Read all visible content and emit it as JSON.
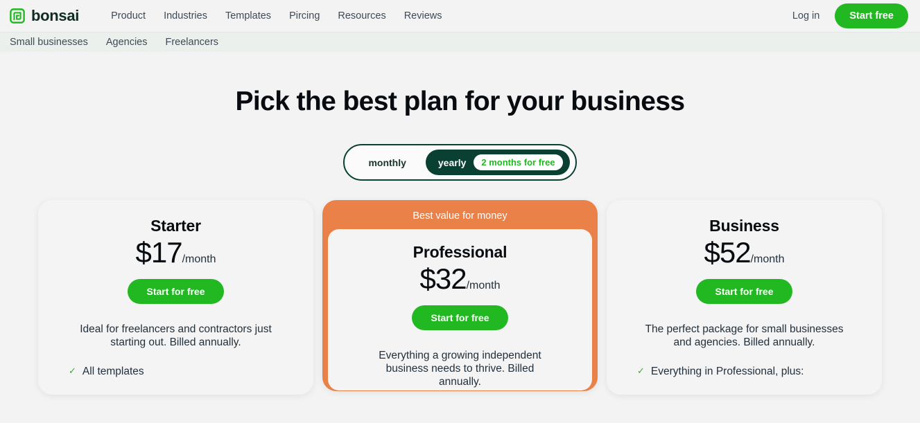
{
  "brand": {
    "name": "bonsai",
    "logo_icon": "bonsai-square-spiral-logo",
    "color": "#21B821"
  },
  "theme": {
    "accent_green": "#21B821",
    "dark_green": "#0A4032",
    "highlight_orange": "#EA8148",
    "page_bg": "#F2F3F2",
    "card_bg": "#F4F4F4",
    "subnav_bg": "#EBF0EC"
  },
  "header": {
    "nav": [
      {
        "label": "Product"
      },
      {
        "label": "Industries"
      },
      {
        "label": "Templates"
      },
      {
        "label": "Pircing"
      },
      {
        "label": "Resources"
      },
      {
        "label": "Reviews"
      }
    ],
    "login_label": "Log in",
    "start_free_label": "Start free"
  },
  "subnav": {
    "items": [
      {
        "label": "Small businesses"
      },
      {
        "label": "Agencies"
      },
      {
        "label": "Freelancers"
      }
    ]
  },
  "hero": {
    "title": "Pick the best plan for your business"
  },
  "billing_toggle": {
    "monthly_label": "monthly",
    "yearly_label": "yearly",
    "yearly_badge": "2 months for free",
    "selected": "yearly"
  },
  "plans": [
    {
      "name": "Starter",
      "price": "$17",
      "period": "/month",
      "cta": "Start for free",
      "description": "Ideal for freelancers and contractors just starting out. Billed annually.",
      "features": [
        "All templates"
      ],
      "highlight": false,
      "ribbon": ""
    },
    {
      "name": "Professional",
      "price": "$32",
      "period": "/month",
      "cta": "Start for free",
      "description": "Everything a growing independent business needs to thrive. Billed annually.",
      "features": [],
      "highlight": true,
      "ribbon": "Best value for money"
    },
    {
      "name": "Business",
      "price": "$52",
      "period": "/month",
      "cta": "Start for free",
      "description": "The perfect package for small businesses and agencies. Billed annually.",
      "features": [
        "Everything in Professional, plus:"
      ],
      "highlight": false,
      "ribbon": ""
    }
  ]
}
